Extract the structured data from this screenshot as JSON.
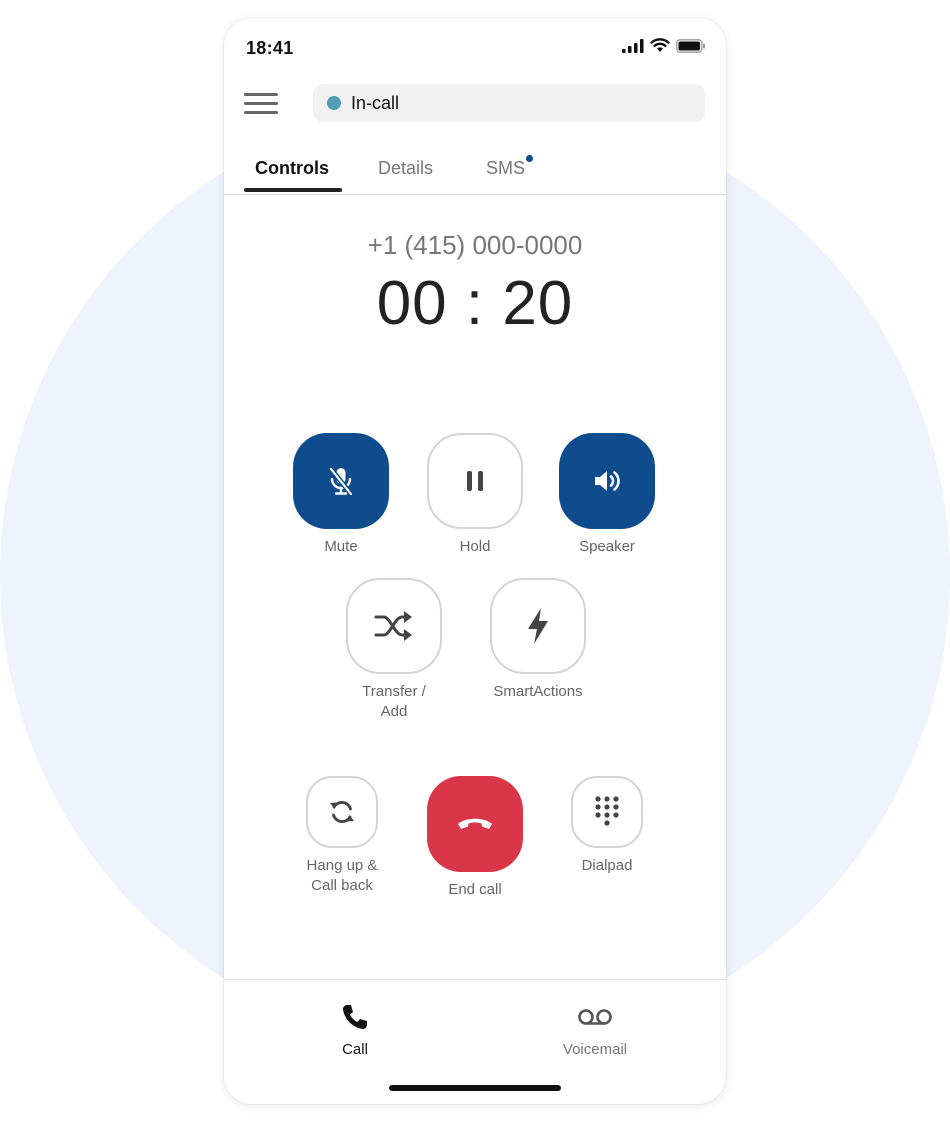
{
  "status_bar": {
    "time": "18:41",
    "icons": [
      "cellular-icon",
      "wifi-icon",
      "battery-icon"
    ]
  },
  "header": {
    "menu_icon": "hamburger-menu-icon",
    "call_status": {
      "label": "In-call",
      "dot_color": "#4f9fb9"
    }
  },
  "tabs": [
    {
      "label": "Controls",
      "active": true
    },
    {
      "label": "Details",
      "active": false
    },
    {
      "label": "SMS",
      "active": false,
      "badge": true
    }
  ],
  "call": {
    "number": "+1 (415) 000-0000",
    "timer": "00 : 20"
  },
  "controls": {
    "mute": {
      "label": "Mute",
      "icon": "mic-off-icon",
      "active": true
    },
    "hold": {
      "label": "Hold",
      "icon": "pause-icon",
      "active": false
    },
    "speaker": {
      "label": "Speaker",
      "icon": "speaker-icon",
      "active": true
    },
    "transfer": {
      "label_line1": "Transfer /",
      "label_line2": "Add",
      "icon": "shuffle-icon"
    },
    "smart_actions": {
      "label": "SmartActions",
      "icon": "lightning-icon"
    },
    "hangup_callback": {
      "label_line1": "Hang up &",
      "label_line2": "Call back",
      "icon": "refresh-icon"
    },
    "end_call": {
      "label": "End call",
      "icon": "phone-hangup-icon"
    },
    "dialpad": {
      "label": "Dialpad",
      "icon": "dialpad-icon"
    }
  },
  "bottom_nav": [
    {
      "label": "Call",
      "icon": "phone-icon",
      "active": true
    },
    {
      "label": "Voicemail",
      "icon": "voicemail-icon",
      "active": false
    }
  ],
  "colors": {
    "accent": "#0f4c8e",
    "danger": "#d9364a",
    "background_circle": "#eef3fc"
  }
}
